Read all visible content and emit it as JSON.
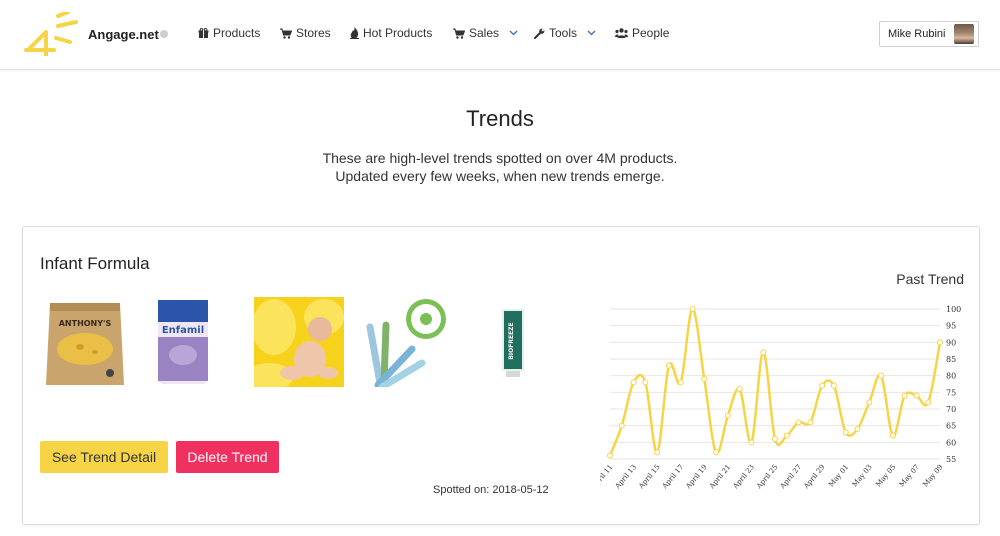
{
  "nav": {
    "brand": "Angage.net",
    "items": [
      {
        "label": "Products",
        "icon": "gift-icon"
      },
      {
        "label": "Stores",
        "icon": "cart-icon"
      },
      {
        "label": "Hot Products",
        "icon": "flame-icon"
      },
      {
        "label": "Sales",
        "icon": "cart-icon",
        "dropdown": true
      },
      {
        "label": "Tools",
        "icon": "wrench-icon",
        "dropdown": true
      },
      {
        "label": "People",
        "icon": "users-icon"
      }
    ],
    "user": "Mike Rubini"
  },
  "header": {
    "title": "Trends",
    "line1": "These are high-level trends spotted on over 4M products.",
    "line2": "Updated every few weeks, when new trends emerge."
  },
  "trend": {
    "name": "Infant Formula",
    "detail_label": "See Trend Detail",
    "delete_label": "Delete Trend",
    "spotted": "Spotted on: 2018-05-12",
    "past_trend_label": "Past Trend",
    "products": [
      {
        "name": "ANTHONY'S"
      },
      {
        "name": "Enfamil"
      },
      {
        "name": "baby-photo"
      },
      {
        "name": "spoons"
      },
      {
        "name": "BIOFREEZE"
      }
    ]
  },
  "colors": {
    "accent_yellow": "#f7d446",
    "danger": "#f0305f",
    "line": "#f5d547"
  },
  "chart_data": {
    "type": "line",
    "title": "",
    "x": [
      "April 11",
      "April 12",
      "April 13",
      "April 14",
      "April 15",
      "April 16",
      "April 17",
      "April 18",
      "April 19",
      "April 20",
      "April 21",
      "April 22",
      "April 23",
      "April 24",
      "April 25",
      "April 26",
      "April 27",
      "April 28",
      "April 29",
      "April 30",
      "May 01",
      "May 02",
      "May 03",
      "May 04",
      "May 05",
      "May 06",
      "May 07",
      "May 08",
      "May 09"
    ],
    "tick_labels": [
      "April 11",
      "April 13",
      "April 15",
      "April 17",
      "April 19",
      "April 21",
      "April 23",
      "April 25",
      "April 27",
      "April 29",
      "May 01",
      "May 03",
      "May 05",
      "May 07",
      "May 09"
    ],
    "series": [
      {
        "values": [
          56,
          65,
          78,
          78,
          57,
          83,
          78,
          100,
          79,
          57,
          68,
          76,
          60,
          87,
          61,
          62,
          66,
          66,
          77,
          77,
          63,
          64,
          72,
          80,
          62,
          74,
          74,
          72,
          90
        ]
      }
    ],
    "ylim": [
      55,
      100
    ],
    "yticks": [
      55,
      60,
      65,
      70,
      75,
      80,
      85,
      90,
      95,
      100
    ],
    "y_axis_side": "right",
    "grid": true
  }
}
